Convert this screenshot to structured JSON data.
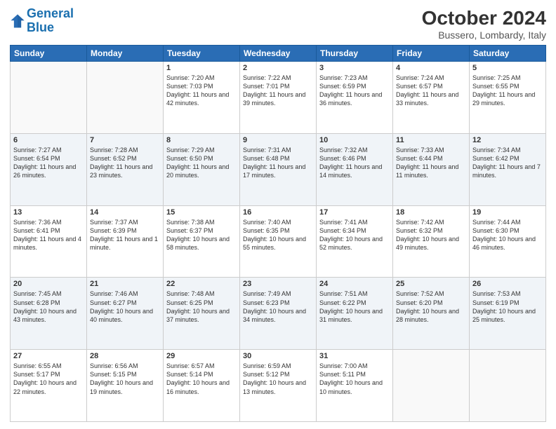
{
  "header": {
    "logo_line1": "General",
    "logo_line2": "Blue",
    "month": "October 2024",
    "location": "Bussero, Lombardy, Italy"
  },
  "days_of_week": [
    "Sunday",
    "Monday",
    "Tuesday",
    "Wednesday",
    "Thursday",
    "Friday",
    "Saturday"
  ],
  "weeks": [
    [
      {
        "day": "",
        "info": ""
      },
      {
        "day": "",
        "info": ""
      },
      {
        "day": "1",
        "info": "Sunrise: 7:20 AM\nSunset: 7:03 PM\nDaylight: 11 hours and 42 minutes."
      },
      {
        "day": "2",
        "info": "Sunrise: 7:22 AM\nSunset: 7:01 PM\nDaylight: 11 hours and 39 minutes."
      },
      {
        "day": "3",
        "info": "Sunrise: 7:23 AM\nSunset: 6:59 PM\nDaylight: 11 hours and 36 minutes."
      },
      {
        "day": "4",
        "info": "Sunrise: 7:24 AM\nSunset: 6:57 PM\nDaylight: 11 hours and 33 minutes."
      },
      {
        "day": "5",
        "info": "Sunrise: 7:25 AM\nSunset: 6:55 PM\nDaylight: 11 hours and 29 minutes."
      }
    ],
    [
      {
        "day": "6",
        "info": "Sunrise: 7:27 AM\nSunset: 6:54 PM\nDaylight: 11 hours and 26 minutes."
      },
      {
        "day": "7",
        "info": "Sunrise: 7:28 AM\nSunset: 6:52 PM\nDaylight: 11 hours and 23 minutes."
      },
      {
        "day": "8",
        "info": "Sunrise: 7:29 AM\nSunset: 6:50 PM\nDaylight: 11 hours and 20 minutes."
      },
      {
        "day": "9",
        "info": "Sunrise: 7:31 AM\nSunset: 6:48 PM\nDaylight: 11 hours and 17 minutes."
      },
      {
        "day": "10",
        "info": "Sunrise: 7:32 AM\nSunset: 6:46 PM\nDaylight: 11 hours and 14 minutes."
      },
      {
        "day": "11",
        "info": "Sunrise: 7:33 AM\nSunset: 6:44 PM\nDaylight: 11 hours and 11 minutes."
      },
      {
        "day": "12",
        "info": "Sunrise: 7:34 AM\nSunset: 6:42 PM\nDaylight: 11 hours and 7 minutes."
      }
    ],
    [
      {
        "day": "13",
        "info": "Sunrise: 7:36 AM\nSunset: 6:41 PM\nDaylight: 11 hours and 4 minutes."
      },
      {
        "day": "14",
        "info": "Sunrise: 7:37 AM\nSunset: 6:39 PM\nDaylight: 11 hours and 1 minute."
      },
      {
        "day": "15",
        "info": "Sunrise: 7:38 AM\nSunset: 6:37 PM\nDaylight: 10 hours and 58 minutes."
      },
      {
        "day": "16",
        "info": "Sunrise: 7:40 AM\nSunset: 6:35 PM\nDaylight: 10 hours and 55 minutes."
      },
      {
        "day": "17",
        "info": "Sunrise: 7:41 AM\nSunset: 6:34 PM\nDaylight: 10 hours and 52 minutes."
      },
      {
        "day": "18",
        "info": "Sunrise: 7:42 AM\nSunset: 6:32 PM\nDaylight: 10 hours and 49 minutes."
      },
      {
        "day": "19",
        "info": "Sunrise: 7:44 AM\nSunset: 6:30 PM\nDaylight: 10 hours and 46 minutes."
      }
    ],
    [
      {
        "day": "20",
        "info": "Sunrise: 7:45 AM\nSunset: 6:28 PM\nDaylight: 10 hours and 43 minutes."
      },
      {
        "day": "21",
        "info": "Sunrise: 7:46 AM\nSunset: 6:27 PM\nDaylight: 10 hours and 40 minutes."
      },
      {
        "day": "22",
        "info": "Sunrise: 7:48 AM\nSunset: 6:25 PM\nDaylight: 10 hours and 37 minutes."
      },
      {
        "day": "23",
        "info": "Sunrise: 7:49 AM\nSunset: 6:23 PM\nDaylight: 10 hours and 34 minutes."
      },
      {
        "day": "24",
        "info": "Sunrise: 7:51 AM\nSunset: 6:22 PM\nDaylight: 10 hours and 31 minutes."
      },
      {
        "day": "25",
        "info": "Sunrise: 7:52 AM\nSunset: 6:20 PM\nDaylight: 10 hours and 28 minutes."
      },
      {
        "day": "26",
        "info": "Sunrise: 7:53 AM\nSunset: 6:19 PM\nDaylight: 10 hours and 25 minutes."
      }
    ],
    [
      {
        "day": "27",
        "info": "Sunrise: 6:55 AM\nSunset: 5:17 PM\nDaylight: 10 hours and 22 minutes."
      },
      {
        "day": "28",
        "info": "Sunrise: 6:56 AM\nSunset: 5:15 PM\nDaylight: 10 hours and 19 minutes."
      },
      {
        "day": "29",
        "info": "Sunrise: 6:57 AM\nSunset: 5:14 PM\nDaylight: 10 hours and 16 minutes."
      },
      {
        "day": "30",
        "info": "Sunrise: 6:59 AM\nSunset: 5:12 PM\nDaylight: 10 hours and 13 minutes."
      },
      {
        "day": "31",
        "info": "Sunrise: 7:00 AM\nSunset: 5:11 PM\nDaylight: 10 hours and 10 minutes."
      },
      {
        "day": "",
        "info": ""
      },
      {
        "day": "",
        "info": ""
      }
    ]
  ]
}
